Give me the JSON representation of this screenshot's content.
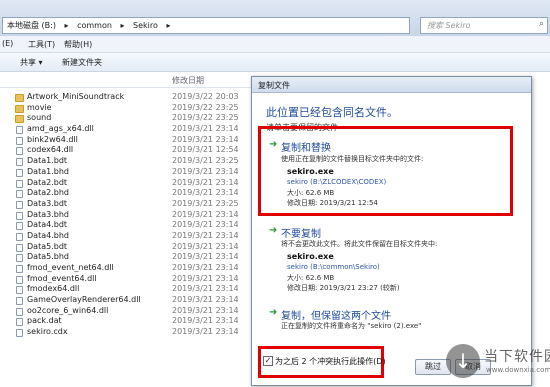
{
  "address": {
    "crumbs": [
      "本地磁盘 (B:)",
      "▸",
      "common",
      "▸",
      "Sekiro",
      "▸"
    ],
    "search_placeholder": "搜索 Sekiro"
  },
  "menu": {
    "items": [
      "(E)",
      "工具(T)",
      "帮助(H)"
    ]
  },
  "toolbar": {
    "share": "共享 ▾",
    "new_folder": "新建文件夹"
  },
  "columns": {
    "date": "修改日期"
  },
  "files": [
    {
      "name": "Artwork_MiniSoundtrack",
      "date": "2019/3/22 20:03",
      "type": "folder"
    },
    {
      "name": "movie",
      "date": "2019/3/22 23:25",
      "type": "folder"
    },
    {
      "name": "sound",
      "date": "2019/3/22 23:25",
      "type": "folder"
    },
    {
      "name": "amd_ags_x64.dll",
      "date": "2019/3/21 23:14",
      "type": "file"
    },
    {
      "name": "bink2w64.dll",
      "date": "2019/3/21 23:14",
      "type": "file"
    },
    {
      "name": "codex64.dll",
      "date": "2019/3/21 12:54",
      "type": "file"
    },
    {
      "name": "Data1.bdt",
      "date": "2019/3/21 23:25",
      "type": "file"
    },
    {
      "name": "Data1.bhd",
      "date": "2019/3/21 23:14",
      "type": "file"
    },
    {
      "name": "Data2.bdt",
      "date": "2019/3/21 23:14",
      "type": "file"
    },
    {
      "name": "Data2.bhd",
      "date": "2019/3/21 23:14",
      "type": "file"
    },
    {
      "name": "Data3.bdt",
      "date": "2019/3/21 23:25",
      "type": "file"
    },
    {
      "name": "Data3.bhd",
      "date": "2019/3/21 23:14",
      "type": "file"
    },
    {
      "name": "Data4.bdt",
      "date": "2019/3/21 23:14",
      "type": "file"
    },
    {
      "name": "Data4.bhd",
      "date": "2019/3/21 23:14",
      "type": "file"
    },
    {
      "name": "Data5.bdt",
      "date": "2019/3/21 23:14",
      "type": "file"
    },
    {
      "name": "Data5.bhd",
      "date": "2019/3/21 23:14",
      "type": "file"
    },
    {
      "name": "fmod_event_net64.dll",
      "date": "2019/3/21 23:14",
      "type": "file"
    },
    {
      "name": "fmod_event64.dll",
      "date": "2019/3/21 23:14",
      "type": "file"
    },
    {
      "name": "fmodex64.dll",
      "date": "2019/3/21 23:14",
      "type": "file"
    },
    {
      "name": "GameOverlayRenderer64.dll",
      "date": "2019/3/21 23:14",
      "type": "file"
    },
    {
      "name": "oo2core_6_win64.dll",
      "date": "2019/3/21 23:14",
      "type": "file"
    },
    {
      "name": "pack.dat",
      "date": "2019/3/21 23:14",
      "type": "file"
    },
    {
      "name": "sekiro.cdx",
      "date": "2019/3/21 23:14",
      "type": "file"
    }
  ],
  "dialog": {
    "title": "复制文件",
    "heading": "此位置已经包含同名文件。",
    "subheading": "请单击要保留的文件",
    "option_replace": {
      "title": "复制和替换",
      "desc": "使用正在复制的文件替换目标文件夹中的文件:",
      "name": "sekiro.exe",
      "path": "sekiro (B:\\ZLCODEX\\CODEX)",
      "size": "大小: 62.6 MB",
      "modified": "修改日期: 2019/3/21 12:54"
    },
    "option_skip": {
      "title": "不要复制",
      "desc": "将不会更改此文件。将此文件保留在目标文件夹中:",
      "name": "sekiro.exe",
      "path": "sekiro (B:\\common\\Sekiro)",
      "size": "大小: 62.6 MB",
      "modified": "修改日期: 2019/3/21 23:27 (较新)"
    },
    "option_keep_both": {
      "title": "复制，但保留这两个文件",
      "desc": "正在复制的文件将重命名为 \"sekiro (2).exe\""
    },
    "checkbox_label": "为之后 2 个冲突执行此操作(D)",
    "checkbox_checked": true,
    "skip_button": "跳过",
    "cancel_button": "取消"
  },
  "watermark": {
    "text": "当下软件园",
    "sub": "www.downxia.com",
    "glyph": "↓"
  },
  "colors": {
    "highlight": "#e00000",
    "link": "#1f4c9e",
    "arrow": "#2a9a3a"
  }
}
